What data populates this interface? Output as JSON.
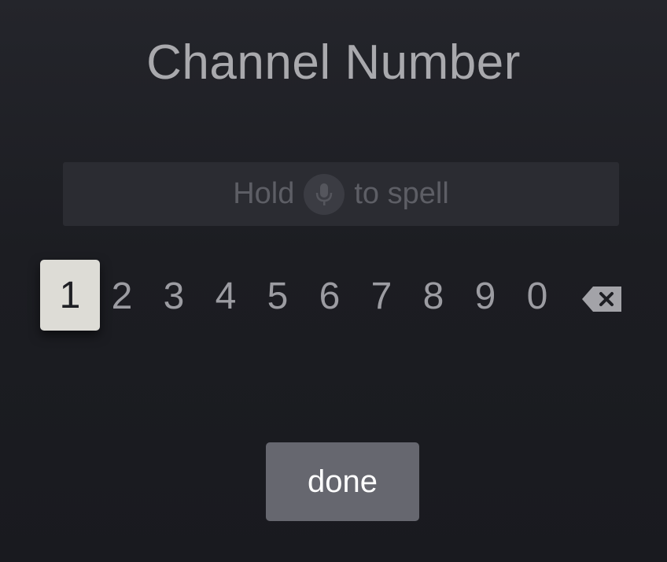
{
  "dialog": {
    "title": "Channel Number"
  },
  "input": {
    "prefix": "Hold",
    "suffix": "to spell",
    "icon": "microphone-icon"
  },
  "keypad": {
    "keys": [
      "1",
      "2",
      "3",
      "4",
      "5",
      "6",
      "7",
      "8",
      "9",
      "0"
    ],
    "focused_key": "1",
    "delete_icon": "backspace-icon"
  },
  "actions": {
    "done_label": "done"
  },
  "colors": {
    "background": "#1e1f24",
    "focused_key": "#dddcd6",
    "button": "#66676f",
    "text_dim": "#5d5e65"
  }
}
